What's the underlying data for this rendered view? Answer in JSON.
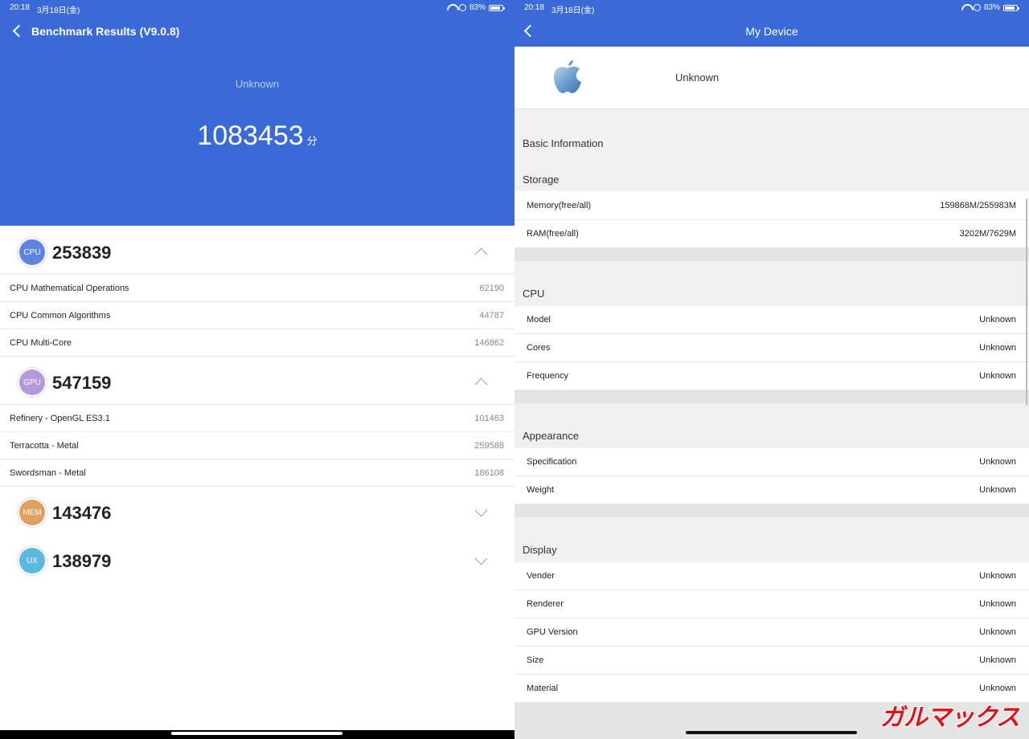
{
  "left": {
    "status": {
      "time": "20:18",
      "date": "3月18日(金)",
      "battery": "83%",
      "battery_level": 0.83
    },
    "header": {
      "title": "Benchmark Results (V9.0.8)",
      "device": "Unknown",
      "total_score": "1083453",
      "score_unit": "分"
    },
    "categories": [
      {
        "badge": "CPU",
        "color": "#5b85e0",
        "score": "253839",
        "expanded": true,
        "items": [
          {
            "label": "CPU Mathematical Operations",
            "value": "62190"
          },
          {
            "label": "CPU Common Algorithms",
            "value": "44787"
          },
          {
            "label": "CPU Multi-Core",
            "value": "146862"
          }
        ]
      },
      {
        "badge": "GPU",
        "color": "#b49ad8",
        "score": "547159",
        "expanded": true,
        "items": [
          {
            "label": "Refinery - OpenGL ES3.1",
            "value": "101463"
          },
          {
            "label": "Terracotta - Metal",
            "value": "259588"
          },
          {
            "label": "Swordsman - Metal",
            "value": "186108"
          }
        ]
      },
      {
        "badge": "MEM",
        "color": "#e0a060",
        "score": "143476",
        "expanded": false
      },
      {
        "badge": "UX",
        "color": "#5bb8e0",
        "score": "138979",
        "expanded": false
      }
    ]
  },
  "right": {
    "status": {
      "time": "20:18",
      "date": "3月18日(金)",
      "battery": "83%",
      "battery_level": 0.83
    },
    "nav": {
      "title": "My Device"
    },
    "device": {
      "name": "Unknown"
    },
    "basic_info_title": "Basic Information",
    "sections": [
      {
        "title": "Storage",
        "rows": [
          {
            "label": "Memory(free/all)",
            "value": "159868M/255983M"
          },
          {
            "label": "RAM(free/all)",
            "value": "3202M/7629M"
          }
        ]
      },
      {
        "title": "CPU",
        "rows": [
          {
            "label": "Model",
            "value": "Unknown"
          },
          {
            "label": "Cores",
            "value": "Unknown"
          },
          {
            "label": "Frequency",
            "value": "Unknown"
          }
        ]
      },
      {
        "title": "Appearance",
        "rows": [
          {
            "label": "Specification",
            "value": "Unknown"
          },
          {
            "label": "Weight",
            "value": "Unknown"
          }
        ]
      },
      {
        "title": "Display",
        "rows": [
          {
            "label": "Vender",
            "value": "Unknown"
          },
          {
            "label": "Renderer",
            "value": "Unknown"
          },
          {
            "label": "GPU Version",
            "value": "Unknown"
          },
          {
            "label": "Size",
            "value": "Unknown"
          },
          {
            "label": "Material",
            "value": "Unknown"
          }
        ]
      }
    ],
    "watermark": "ガルマックス"
  }
}
